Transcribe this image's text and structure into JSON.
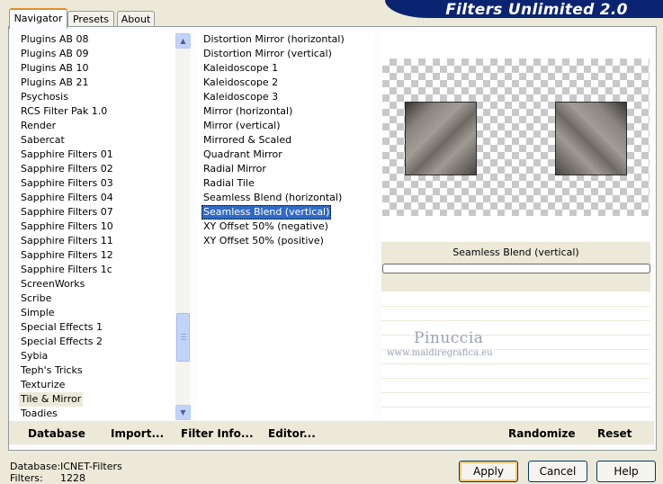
{
  "window": {
    "title": "Filters Unlimited 2.0"
  },
  "tabs": [
    {
      "label": "Navigator",
      "active": true
    },
    {
      "label": "Presets",
      "active": false
    },
    {
      "label": "About",
      "active": false
    }
  ],
  "categories": {
    "items": [
      "Plugins AB 08",
      "Plugins AB 09",
      "Plugins AB 10",
      "Plugins AB 21",
      "Psychosis",
      "RCS Filter Pak 1.0",
      "Render",
      "Sabercat",
      "Sapphire Filters 01",
      "Sapphire Filters 02",
      "Sapphire Filters 03",
      "Sapphire Filters 04",
      "Sapphire Filters 07",
      "Sapphire Filters 10",
      "Sapphire Filters 11",
      "Sapphire Filters 12",
      "Sapphire Filters 1c",
      "ScreenWorks",
      "Scribe",
      "Simple",
      "Special Effects 1",
      "Special Effects 2",
      "Sybia",
      "Teph's Tricks",
      "Texturize",
      "Tile & Mirror",
      "Toadies"
    ],
    "selected": "Tile & Mirror"
  },
  "filters": {
    "items": [
      "Distortion Mirror (horizontal)",
      "Distortion Mirror (vertical)",
      "Kaleidoscope 1",
      "Kaleidoscope 2",
      "Kaleidoscope 3",
      "Mirror (horizontal)",
      "Mirror (vertical)",
      "Mirrored & Scaled",
      "Quadrant Mirror",
      "Radial Mirror",
      "Radial Tile",
      "Seamless Blend (horizontal)",
      "Seamless Blend (vertical)",
      "XY Offset 50% (negative)",
      "XY Offset 50% (positive)"
    ],
    "selected": "Seamless Blend (vertical)"
  },
  "preview": {
    "filter_name": "Seamless Blend (vertical)",
    "progress": 0
  },
  "watermark": {
    "name": "Pinuccia",
    "url": "www.maidiregrafica.eu"
  },
  "actions": {
    "database": "Database",
    "import": "Import...",
    "filter_info": "Filter Info...",
    "editor": "Editor...",
    "randomize": "Randomize",
    "reset": "Reset"
  },
  "status": {
    "database_label": "Database:",
    "database_value": "ICNET-Filters",
    "filters_label": "Filters:",
    "filters_value": "1228"
  },
  "buttons": {
    "apply": "Apply",
    "cancel": "Cancel",
    "help": "Help"
  },
  "colors": {
    "banner": "#0b2472",
    "selection": "#316ac5",
    "dialog_bg": "#ece9d8"
  }
}
